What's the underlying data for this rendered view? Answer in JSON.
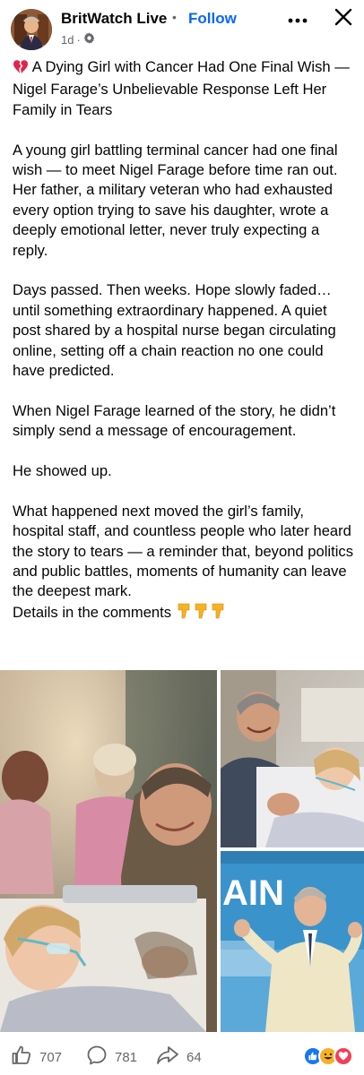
{
  "header": {
    "page_name": "BritWatch Live",
    "separator": "•",
    "follow_label": "Follow",
    "time_ago": "1d",
    "time_dot": "·"
  },
  "post": {
    "title": "A Dying Girl with Cancer Had One Final Wish — Nigel Farage’s Unbelievable Response Left Her Family in Tears",
    "paragraphs": [
      "A young girl battling terminal cancer had one final wish — to meet Nigel Farage before time ran out. Her father, a military veteran who had exhausted every option trying to save his daughter, wrote a deeply emotional letter, never truly expecting a reply.",
      "Days passed. Then weeks. Hope slowly faded… until something extraordinary happened. A quiet post shared by a hospital nurse began circulating online, setting off a chain reaction no one could have predicted.",
      "When Nigel Farage learned of the story, he didn’t simply send a message of encouragement.",
      "He showed up.",
      "What happened next moved the girl’s family, hospital staff, and countless people who later heard the story to tears — a reminder that, beyond politics and public battles, moments of humanity can leave the deepest mark."
    ],
    "cta": "Details in the comments",
    "sign_text": "AIN"
  },
  "footer": {
    "likes": "707",
    "comments": "781",
    "shares": "64"
  },
  "icons": {
    "title_emoji": "broken-heart-icon",
    "cta_emoji": "pointing-down-icon",
    "like": "thumbs-up-icon",
    "comment": "comment-icon",
    "share": "share-icon",
    "reactions": [
      "like-reaction-icon",
      "haha-reaction-icon",
      "love-reaction-icon"
    ]
  },
  "colors": {
    "accent": "#0866ff",
    "secondary_text": "#65676b",
    "broken_heart": "#e0244a",
    "like_reaction": "#1877f2",
    "love_reaction": "#f33e58",
    "haha_reaction": "#f7b125"
  }
}
